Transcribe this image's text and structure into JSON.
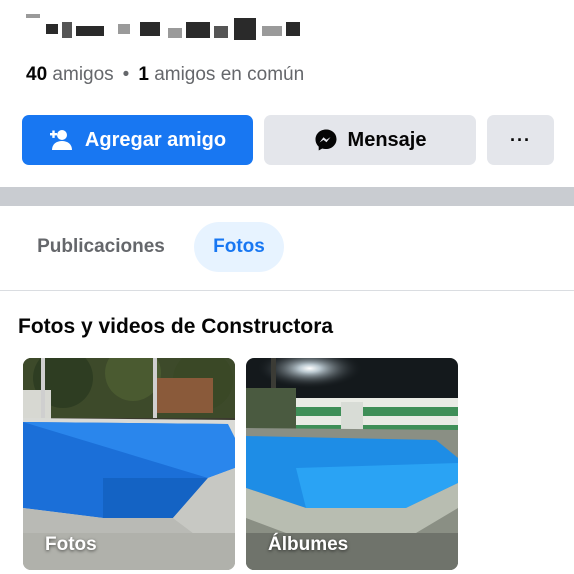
{
  "profile": {
    "friend_count": "40",
    "friends_label": "amigos",
    "separator": "•",
    "mutual_count": "1",
    "mutual_label": "amigos en común"
  },
  "actions": {
    "add_friend": "Agregar amigo",
    "message": "Mensaje",
    "more": "···"
  },
  "tabs": [
    {
      "label": "Publicaciones",
      "selected": false
    },
    {
      "label": "Fotos",
      "selected": true
    }
  ],
  "section": {
    "title": "Fotos y videos de Constructora"
  },
  "cards": [
    {
      "label": "Fotos",
      "icon": "pool-photo"
    },
    {
      "label": "Álbumes",
      "icon": "pool-night-photo"
    }
  ],
  "colors": {
    "accent": "#1877f2",
    "button_gray": "#e4e6eb",
    "divider": "#c9ccd1"
  }
}
